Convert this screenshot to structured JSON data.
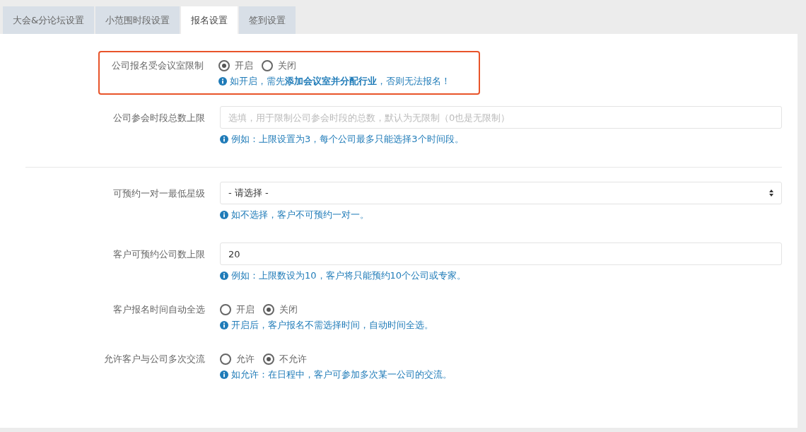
{
  "tabs": [
    {
      "label": "大会&分论坛设置",
      "selected": false
    },
    {
      "label": "小范围时段设置",
      "selected": false
    },
    {
      "label": "报名设置",
      "selected": true
    },
    {
      "label": "签到设置",
      "selected": false
    }
  ],
  "form": {
    "rows": [
      {
        "kind": "radio",
        "highlighted": true,
        "label": "公司报名受会议室限制",
        "options": [
          {
            "label": "开启",
            "selected": true
          },
          {
            "label": "关闭",
            "selected": false
          }
        ],
        "hint": "如开启，需先**添加会议室并分配行业**，否则无法报名！"
      },
      {
        "kind": "text",
        "highlighted": false,
        "label": "公司参会时段总数上限",
        "placeholder": "选填，用于限制公司参会时段的总数，默认为无限制（0也是无限制）",
        "hint": "例如：上限设置为3，每个公司最多只能选择3个时间段。"
      },
      {
        "kind": "divider"
      },
      {
        "kind": "select",
        "highlighted": false,
        "label": "可预约一对一最低星级",
        "value": "- 请选择 -",
        "hint": "如不选择，客户不可预约一对一。"
      },
      {
        "kind": "text",
        "highlighted": false,
        "label": "客户可预约公司数上限",
        "value": "20",
        "hint": "例如：上限数设为10，客户将只能预约10个公司或专家。"
      },
      {
        "kind": "radio",
        "highlighted": false,
        "label": "客户报名时间自动全选",
        "options": [
          {
            "label": "开启",
            "selected": false
          },
          {
            "label": "关闭",
            "selected": true
          }
        ],
        "hint": "开启后，客户报名不需选择时间，自动时间全选。"
      },
      {
        "kind": "radio",
        "highlighted": false,
        "label": "允许客户与公司多次交流",
        "options": [
          {
            "label": "允许",
            "selected": false
          },
          {
            "label": "不允许",
            "selected": true
          }
        ],
        "hint": "如允许：在日程中，客户可参加多次某一公司的交流。"
      }
    ]
  }
}
